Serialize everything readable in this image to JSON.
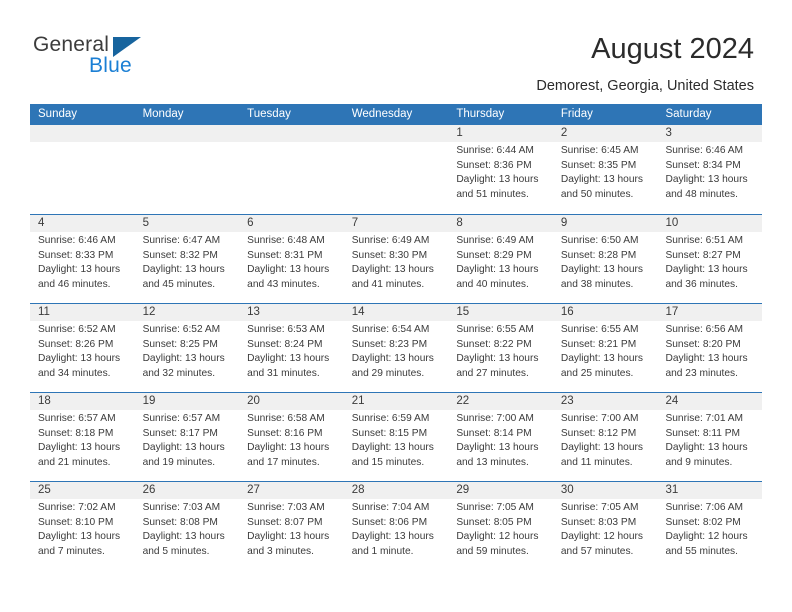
{
  "brand": {
    "name_part1": "General",
    "name_part2": "Blue",
    "accent_color": "#1b7fd4",
    "triangle_color": "#17649e"
  },
  "header": {
    "title": "August 2024",
    "location": "Demorest, Georgia, United States",
    "header_bg_color": "#2e75b6"
  },
  "weekday_headers": [
    "Sunday",
    "Monday",
    "Tuesday",
    "Wednesday",
    "Thursday",
    "Friday",
    "Saturday"
  ],
  "weeks": [
    [
      {
        "day": "",
        "sunrise": "",
        "sunset": "",
        "daylight": "",
        "daylight2": ""
      },
      {
        "day": "",
        "sunrise": "",
        "sunset": "",
        "daylight": "",
        "daylight2": ""
      },
      {
        "day": "",
        "sunrise": "",
        "sunset": "",
        "daylight": "",
        "daylight2": ""
      },
      {
        "day": "",
        "sunrise": "",
        "sunset": "",
        "daylight": "",
        "daylight2": ""
      },
      {
        "day": "1",
        "sunrise": "Sunrise: 6:44 AM",
        "sunset": "Sunset: 8:36 PM",
        "daylight": "Daylight: 13 hours",
        "daylight2": "and 51 minutes."
      },
      {
        "day": "2",
        "sunrise": "Sunrise: 6:45 AM",
        "sunset": "Sunset: 8:35 PM",
        "daylight": "Daylight: 13 hours",
        "daylight2": "and 50 minutes."
      },
      {
        "day": "3",
        "sunrise": "Sunrise: 6:46 AM",
        "sunset": "Sunset: 8:34 PM",
        "daylight": "Daylight: 13 hours",
        "daylight2": "and 48 minutes."
      }
    ],
    [
      {
        "day": "4",
        "sunrise": "Sunrise: 6:46 AM",
        "sunset": "Sunset: 8:33 PM",
        "daylight": "Daylight: 13 hours",
        "daylight2": "and 46 minutes."
      },
      {
        "day": "5",
        "sunrise": "Sunrise: 6:47 AM",
        "sunset": "Sunset: 8:32 PM",
        "daylight": "Daylight: 13 hours",
        "daylight2": "and 45 minutes."
      },
      {
        "day": "6",
        "sunrise": "Sunrise: 6:48 AM",
        "sunset": "Sunset: 8:31 PM",
        "daylight": "Daylight: 13 hours",
        "daylight2": "and 43 minutes."
      },
      {
        "day": "7",
        "sunrise": "Sunrise: 6:49 AM",
        "sunset": "Sunset: 8:30 PM",
        "daylight": "Daylight: 13 hours",
        "daylight2": "and 41 minutes."
      },
      {
        "day": "8",
        "sunrise": "Sunrise: 6:49 AM",
        "sunset": "Sunset: 8:29 PM",
        "daylight": "Daylight: 13 hours",
        "daylight2": "and 40 minutes."
      },
      {
        "day": "9",
        "sunrise": "Sunrise: 6:50 AM",
        "sunset": "Sunset: 8:28 PM",
        "daylight": "Daylight: 13 hours",
        "daylight2": "and 38 minutes."
      },
      {
        "day": "10",
        "sunrise": "Sunrise: 6:51 AM",
        "sunset": "Sunset: 8:27 PM",
        "daylight": "Daylight: 13 hours",
        "daylight2": "and 36 minutes."
      }
    ],
    [
      {
        "day": "11",
        "sunrise": "Sunrise: 6:52 AM",
        "sunset": "Sunset: 8:26 PM",
        "daylight": "Daylight: 13 hours",
        "daylight2": "and 34 minutes."
      },
      {
        "day": "12",
        "sunrise": "Sunrise: 6:52 AM",
        "sunset": "Sunset: 8:25 PM",
        "daylight": "Daylight: 13 hours",
        "daylight2": "and 32 minutes."
      },
      {
        "day": "13",
        "sunrise": "Sunrise: 6:53 AM",
        "sunset": "Sunset: 8:24 PM",
        "daylight": "Daylight: 13 hours",
        "daylight2": "and 31 minutes."
      },
      {
        "day": "14",
        "sunrise": "Sunrise: 6:54 AM",
        "sunset": "Sunset: 8:23 PM",
        "daylight": "Daylight: 13 hours",
        "daylight2": "and 29 minutes."
      },
      {
        "day": "15",
        "sunrise": "Sunrise: 6:55 AM",
        "sunset": "Sunset: 8:22 PM",
        "daylight": "Daylight: 13 hours",
        "daylight2": "and 27 minutes."
      },
      {
        "day": "16",
        "sunrise": "Sunrise: 6:55 AM",
        "sunset": "Sunset: 8:21 PM",
        "daylight": "Daylight: 13 hours",
        "daylight2": "and 25 minutes."
      },
      {
        "day": "17",
        "sunrise": "Sunrise: 6:56 AM",
        "sunset": "Sunset: 8:20 PM",
        "daylight": "Daylight: 13 hours",
        "daylight2": "and 23 minutes."
      }
    ],
    [
      {
        "day": "18",
        "sunrise": "Sunrise: 6:57 AM",
        "sunset": "Sunset: 8:18 PM",
        "daylight": "Daylight: 13 hours",
        "daylight2": "and 21 minutes."
      },
      {
        "day": "19",
        "sunrise": "Sunrise: 6:57 AM",
        "sunset": "Sunset: 8:17 PM",
        "daylight": "Daylight: 13 hours",
        "daylight2": "and 19 minutes."
      },
      {
        "day": "20",
        "sunrise": "Sunrise: 6:58 AM",
        "sunset": "Sunset: 8:16 PM",
        "daylight": "Daylight: 13 hours",
        "daylight2": "and 17 minutes."
      },
      {
        "day": "21",
        "sunrise": "Sunrise: 6:59 AM",
        "sunset": "Sunset: 8:15 PM",
        "daylight": "Daylight: 13 hours",
        "daylight2": "and 15 minutes."
      },
      {
        "day": "22",
        "sunrise": "Sunrise: 7:00 AM",
        "sunset": "Sunset: 8:14 PM",
        "daylight": "Daylight: 13 hours",
        "daylight2": "and 13 minutes."
      },
      {
        "day": "23",
        "sunrise": "Sunrise: 7:00 AM",
        "sunset": "Sunset: 8:12 PM",
        "daylight": "Daylight: 13 hours",
        "daylight2": "and 11 minutes."
      },
      {
        "day": "24",
        "sunrise": "Sunrise: 7:01 AM",
        "sunset": "Sunset: 8:11 PM",
        "daylight": "Daylight: 13 hours",
        "daylight2": "and 9 minutes."
      }
    ],
    [
      {
        "day": "25",
        "sunrise": "Sunrise: 7:02 AM",
        "sunset": "Sunset: 8:10 PM",
        "daylight": "Daylight: 13 hours",
        "daylight2": "and 7 minutes."
      },
      {
        "day": "26",
        "sunrise": "Sunrise: 7:03 AM",
        "sunset": "Sunset: 8:08 PM",
        "daylight": "Daylight: 13 hours",
        "daylight2": "and 5 minutes."
      },
      {
        "day": "27",
        "sunrise": "Sunrise: 7:03 AM",
        "sunset": "Sunset: 8:07 PM",
        "daylight": "Daylight: 13 hours",
        "daylight2": "and 3 minutes."
      },
      {
        "day": "28",
        "sunrise": "Sunrise: 7:04 AM",
        "sunset": "Sunset: 8:06 PM",
        "daylight": "Daylight: 13 hours",
        "daylight2": "and 1 minute."
      },
      {
        "day": "29",
        "sunrise": "Sunrise: 7:05 AM",
        "sunset": "Sunset: 8:05 PM",
        "daylight": "Daylight: 12 hours",
        "daylight2": "and 59 minutes."
      },
      {
        "day": "30",
        "sunrise": "Sunrise: 7:05 AM",
        "sunset": "Sunset: 8:03 PM",
        "daylight": "Daylight: 12 hours",
        "daylight2": "and 57 minutes."
      },
      {
        "day": "31",
        "sunrise": "Sunrise: 7:06 AM",
        "sunset": "Sunset: 8:02 PM",
        "daylight": "Daylight: 12 hours",
        "daylight2": "and 55 minutes."
      }
    ]
  ]
}
